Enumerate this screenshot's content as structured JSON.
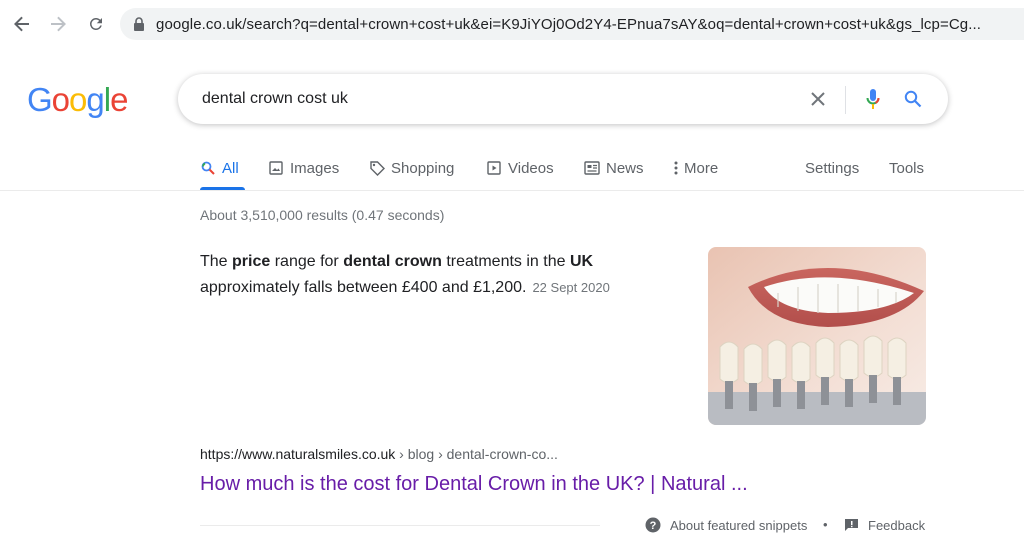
{
  "browser": {
    "url": "google.co.uk/search?q=dental+crown+cost+uk&ei=K9JiYOj0Od2Y4-EPnua7sAY&oq=dental+crown+cost+uk&gs_lcp=Cg..."
  },
  "logo": {
    "letters": [
      "G",
      "o",
      "o",
      "g",
      "l",
      "e"
    ],
    "colors": [
      "#4285f4",
      "#ea4335",
      "#fbbc05",
      "#4285f4",
      "#34a853",
      "#ea4335"
    ]
  },
  "search": {
    "query": "dental crown cost uk"
  },
  "tabs": [
    {
      "label": "All",
      "icon": "search-icon",
      "active": true
    },
    {
      "label": "Images",
      "icon": "image-icon"
    },
    {
      "label": "Shopping",
      "icon": "tag-icon"
    },
    {
      "label": "Videos",
      "icon": "play-icon"
    },
    {
      "label": "News",
      "icon": "newspaper-icon"
    },
    {
      "label": "More",
      "icon": "more-vert-icon"
    },
    {
      "label": "Settings"
    },
    {
      "label": "Tools"
    }
  ],
  "results": {
    "stats": "About 3,510,000 results (0.47 seconds)",
    "snippet": {
      "part1": "The ",
      "bold1": "price",
      "part2": " range for ",
      "bold2": "dental crown",
      "part3": " treatments in the ",
      "bold3": "UK",
      "part4": " approximately falls between £400 and £1,200.",
      "date": "22 Sept 2020"
    },
    "cite": {
      "domain": "https://www.naturalsmiles.co.uk",
      "crumbs": " › blog › dental-crown-co..."
    },
    "title": "How much is the cost for Dental Crown in the UK? | Natural ..."
  },
  "footer": {
    "about_label": "About featured snippets",
    "separator": "•",
    "feedback_label": "Feedback"
  },
  "colors": {
    "accent": "#1a73e8",
    "visited_link": "#681da8"
  }
}
